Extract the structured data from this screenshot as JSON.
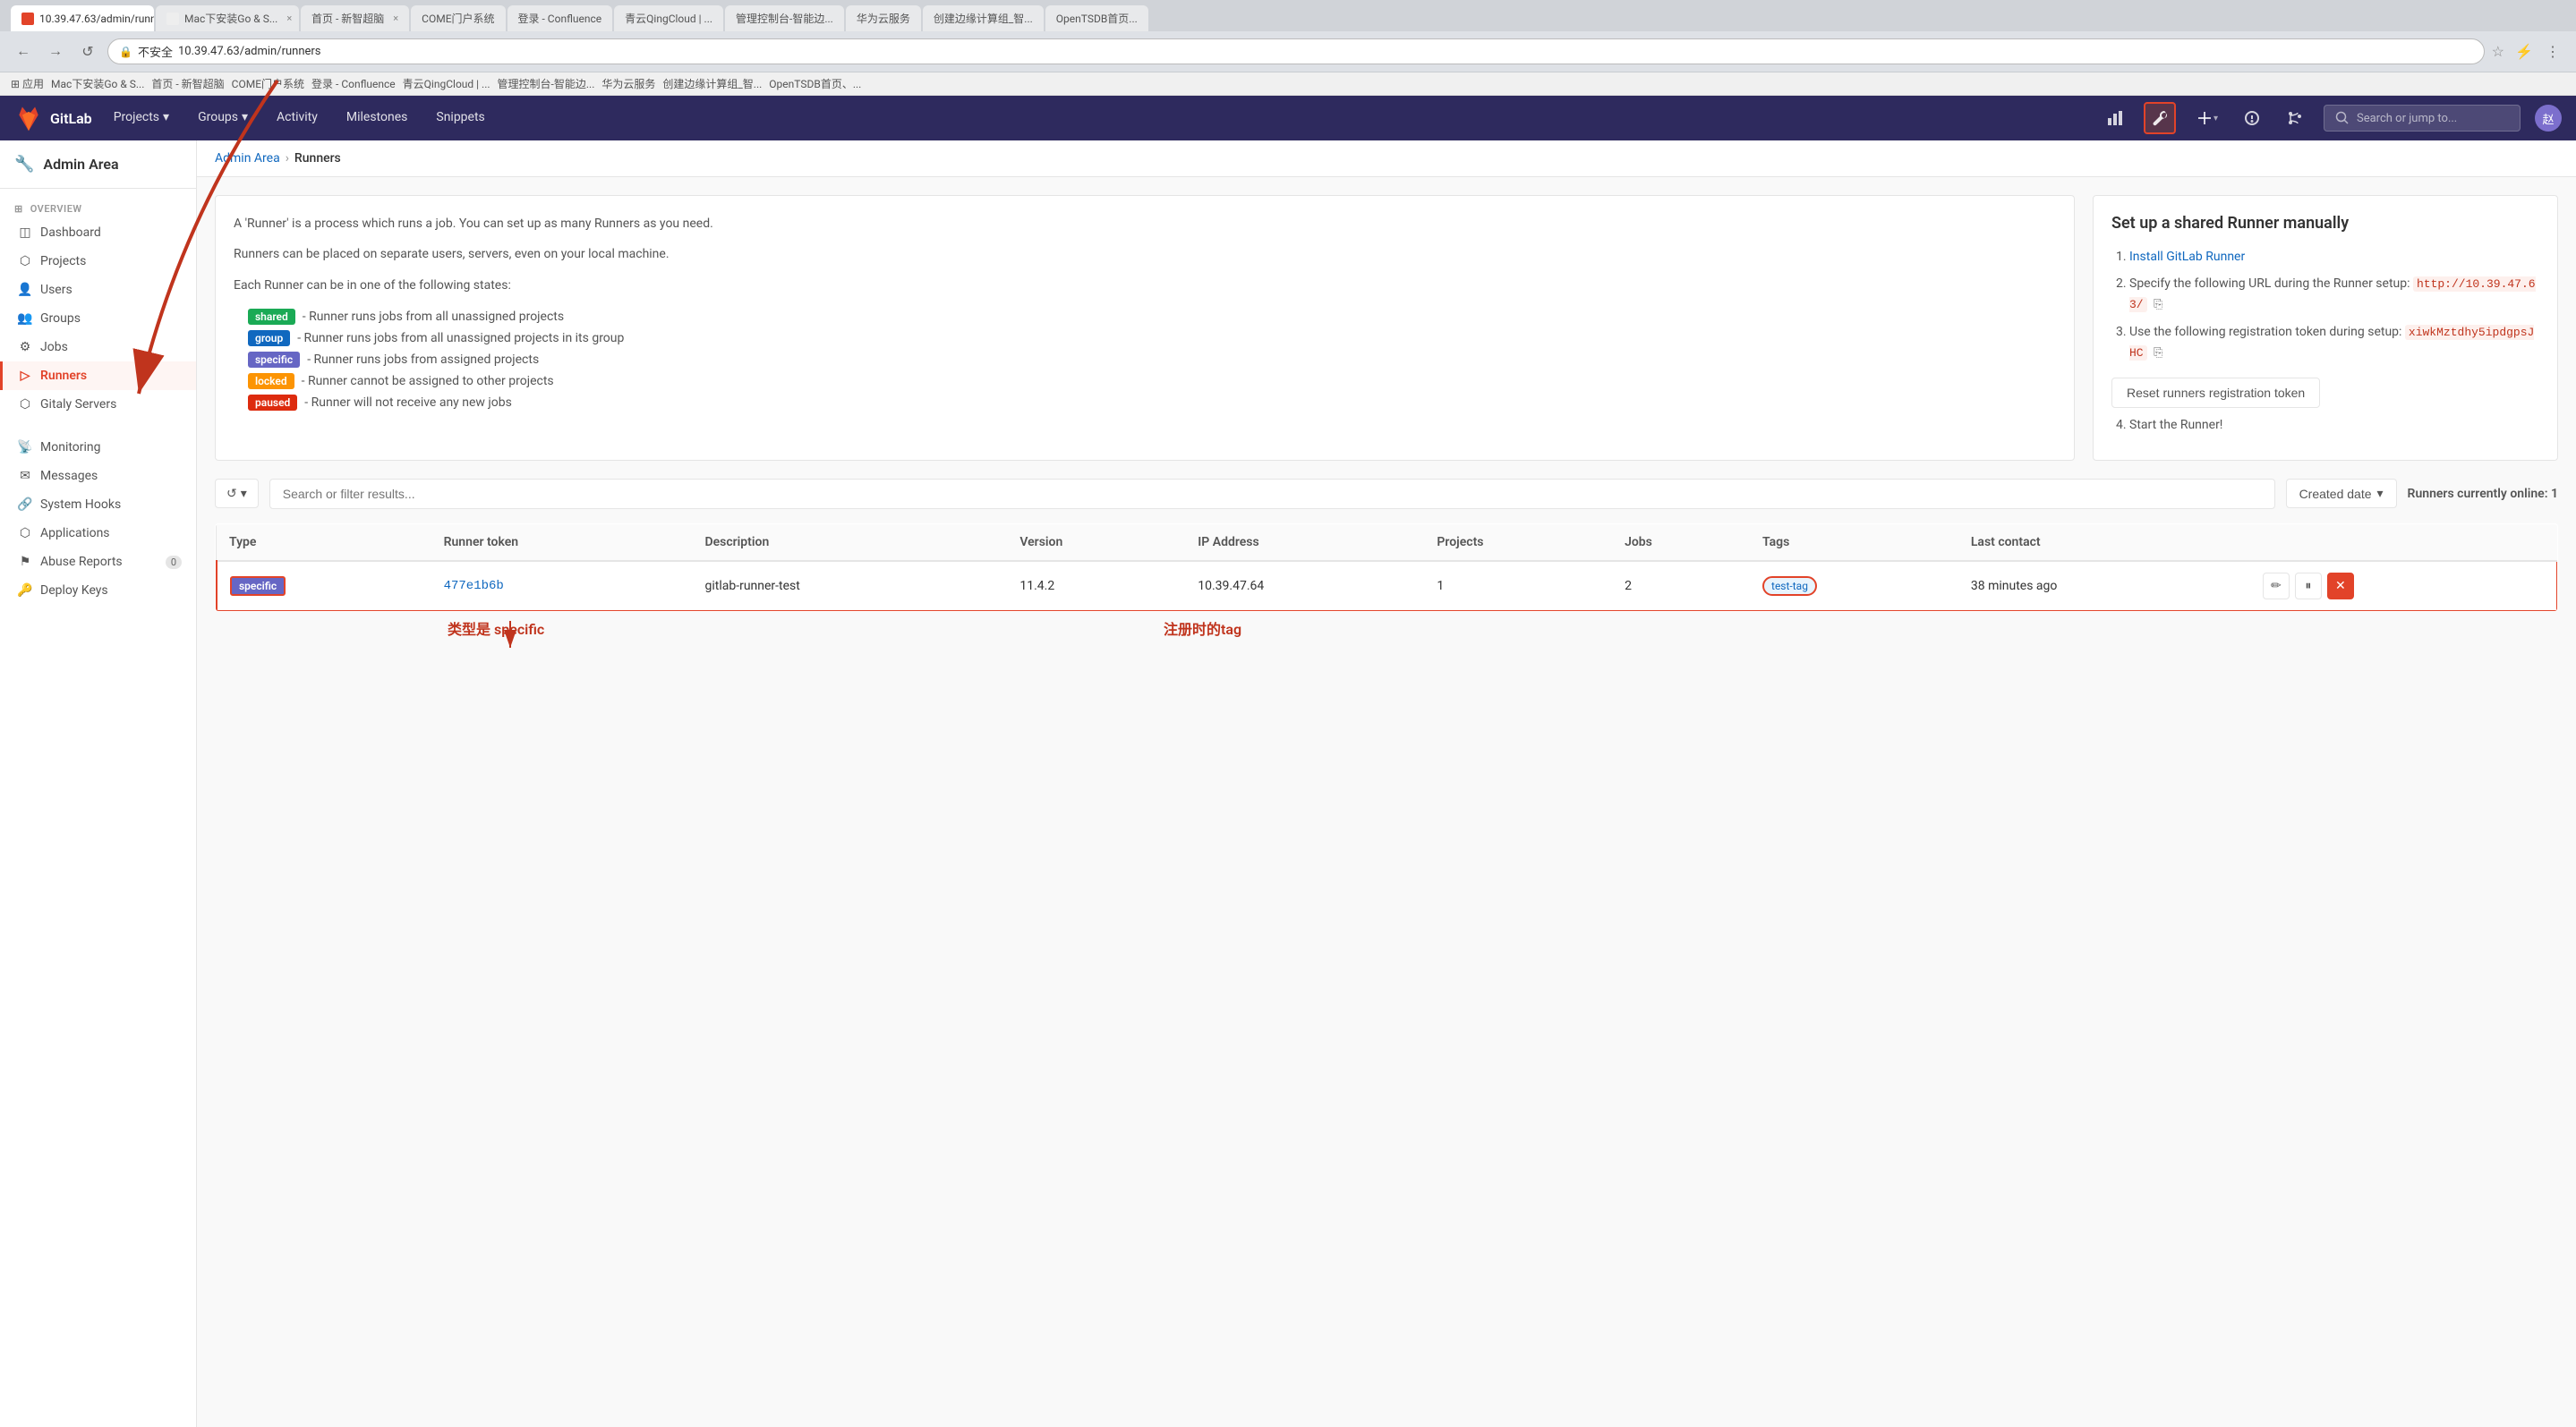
{
  "browser": {
    "address": "10.39.47.63/admin/runners",
    "security_label": "不安全",
    "tabs": [
      {
        "label": "应用",
        "active": false
      },
      {
        "label": "Mac下安装Go & S...",
        "active": false
      },
      {
        "label": "首页 - 新智超脑",
        "active": false
      },
      {
        "label": "COME门户系统",
        "active": false
      },
      {
        "label": "登录 - Confluence",
        "active": false
      },
      {
        "label": "青云QingCloud | ...",
        "active": false
      },
      {
        "label": "管理控制台-智能边...",
        "active": false
      },
      {
        "label": "华为云服务",
        "active": false
      },
      {
        "label": "创建边缘计算组_智...",
        "active": false
      },
      {
        "label": "OpenTSDB首页、...",
        "active": false
      }
    ]
  },
  "nav": {
    "logo_text": "GitLab",
    "links": [
      "Projects",
      "Groups",
      "Activity",
      "Milestones",
      "Snippets"
    ],
    "search_placeholder": "Search or jump to...",
    "avatar_initials": "赵"
  },
  "breadcrumb": {
    "parent": "Admin Area",
    "current": "Runners"
  },
  "sidebar": {
    "title": "Admin Area",
    "sections": [
      {
        "header": "Overview",
        "items": [
          {
            "label": "Dashboard",
            "active": false
          },
          {
            "label": "Projects",
            "active": false
          },
          {
            "label": "Users",
            "active": false
          },
          {
            "label": "Groups",
            "active": false
          },
          {
            "label": "Jobs",
            "active": false
          },
          {
            "label": "Runners",
            "active": true
          },
          {
            "label": "Gitaly Servers",
            "active": false
          }
        ]
      },
      {
        "header": "",
        "items": [
          {
            "label": "Monitoring",
            "active": false
          },
          {
            "label": "Messages",
            "active": false
          },
          {
            "label": "System Hooks",
            "active": false
          },
          {
            "label": "Applications",
            "active": false
          },
          {
            "label": "Abuse Reports",
            "badge": "0",
            "active": false
          },
          {
            "label": "Deploy Keys",
            "active": false
          }
        ]
      }
    ]
  },
  "info_section": {
    "description": "A 'Runner' is a process which runs a job. You can set up as many Runners as you need.",
    "description2": "Runners can be placed on separate users, servers, even on your local machine.",
    "states_header": "Each Runner can be in one of the following states:",
    "states": [
      {
        "badge": "shared",
        "badge_class": "badge-shared",
        "text": "Runner runs jobs from all unassigned projects"
      },
      {
        "badge": "group",
        "badge_class": "badge-group",
        "text": "Runner runs jobs from all unassigned projects in its group"
      },
      {
        "badge": "specific",
        "badge_class": "badge-specific",
        "text": "Runner runs jobs from assigned projects"
      },
      {
        "badge": "locked",
        "badge_class": "badge-locked",
        "text": "Runner cannot be assigned to other projects"
      },
      {
        "badge": "paused",
        "badge_class": "badge-paused",
        "text": "Runner will not receive any new jobs"
      }
    ]
  },
  "setup_section": {
    "title": "Set up a shared Runner manually",
    "steps": [
      {
        "num": 1,
        "text": "Install GitLab Runner",
        "link": "Install GitLab Runner"
      },
      {
        "num": 2,
        "text": "Specify the following URL during the Runner setup:",
        "code": "http://10.39.47.63/"
      },
      {
        "num": 3,
        "text": "Use the following registration token during setup:",
        "code": "xiwkMztdhy5ipdgpsJHC"
      },
      {
        "num": 4,
        "text": "Start the Runner!"
      }
    ],
    "reset_btn": "Reset runners registration token"
  },
  "table": {
    "controls": {
      "search_placeholder": "Search or filter results...",
      "sort_label": "Created date",
      "online_label": "Runners currently online:",
      "online_count": "1"
    },
    "columns": [
      "Type",
      "Runner token",
      "Description",
      "Version",
      "IP Address",
      "Projects",
      "Jobs",
      "Tags",
      "Last contact"
    ],
    "rows": [
      {
        "type": "specific",
        "token": "477e1b6b",
        "description": "gitlab-runner-test",
        "version": "11.4.2",
        "ip": "10.39.47.64",
        "projects": "1",
        "jobs": "2",
        "tags": [
          "test-tag"
        ],
        "last_contact": "38 minutes ago"
      }
    ]
  },
  "annotations": {
    "type_label": "类型是 specific",
    "tag_label": "注册时的tag"
  },
  "activity_tab": "Activity"
}
